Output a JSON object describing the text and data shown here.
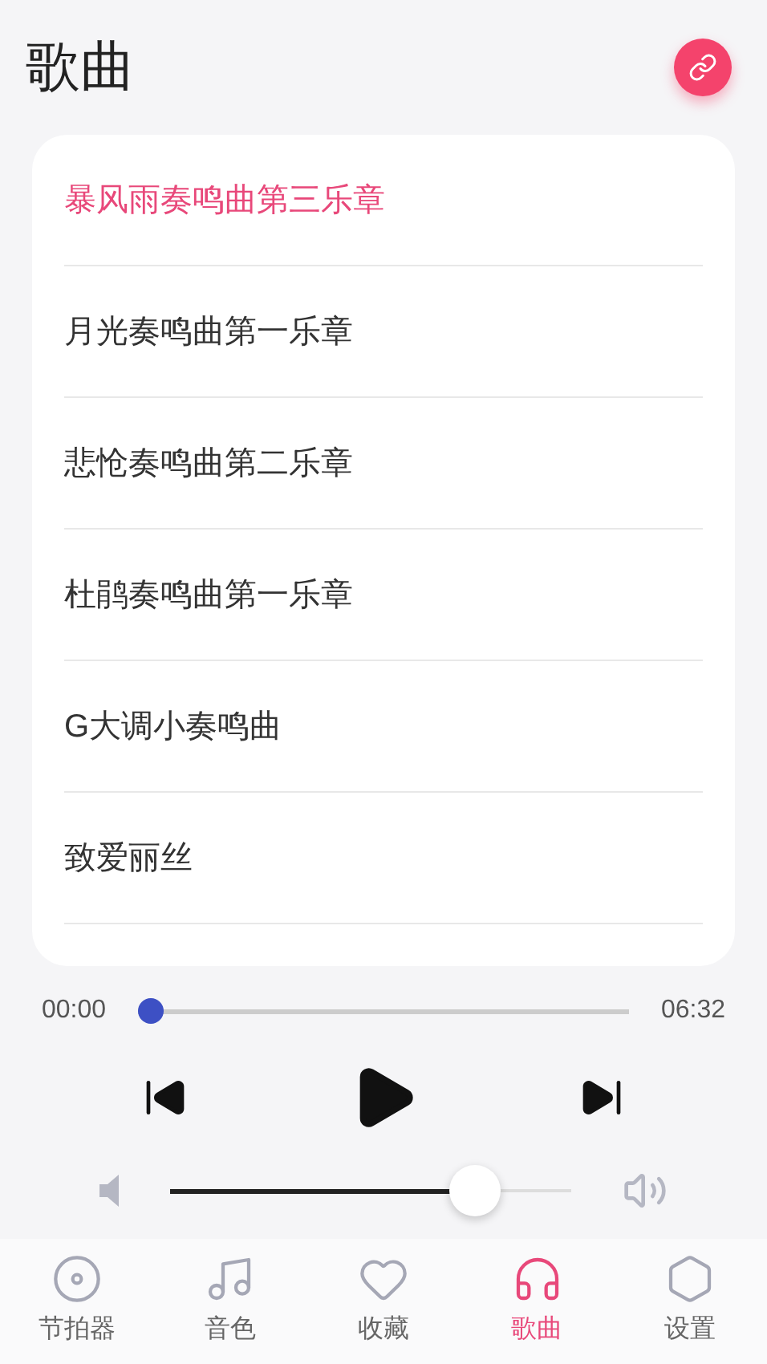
{
  "header": {
    "title": "歌曲"
  },
  "songs": [
    {
      "title": "暴风雨奏鸣曲第三乐章",
      "selected": true
    },
    {
      "title": "月光奏鸣曲第一乐章",
      "selected": false
    },
    {
      "title": "悲怆奏鸣曲第二乐章",
      "selected": false
    },
    {
      "title": "杜鹃奏鸣曲第一乐章",
      "selected": false
    },
    {
      "title": "G大调小奏鸣曲",
      "selected": false
    },
    {
      "title": "致爱丽丝",
      "selected": false
    }
  ],
  "player": {
    "elapsed": "00:00",
    "duration": "06:32",
    "progress": {
      "level": 0
    },
    "volume": {
      "level": 0.8
    }
  },
  "tabs": [
    {
      "label": "节拍器",
      "kind": "metronome",
      "selected": false
    },
    {
      "label": "音色",
      "kind": "tone",
      "selected": false
    },
    {
      "label": "收藏",
      "kind": "favorites",
      "selected": false
    },
    {
      "label": "歌曲",
      "kind": "songs",
      "selected": true
    },
    {
      "label": "设置",
      "kind": "settings",
      "selected": false
    }
  ]
}
